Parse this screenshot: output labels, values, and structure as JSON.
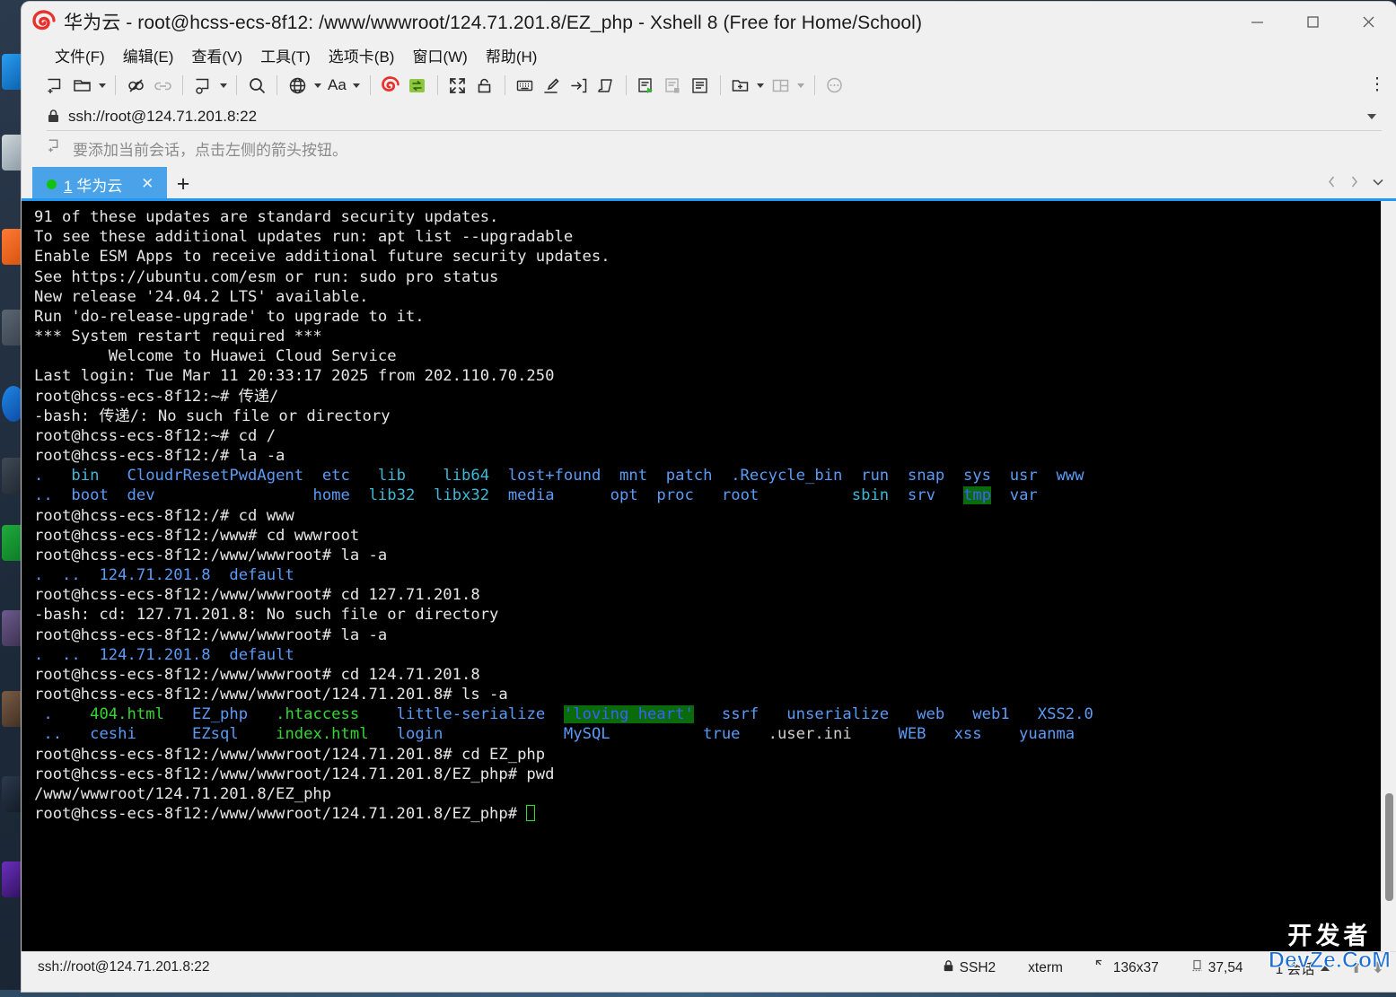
{
  "window": {
    "title": "华为云 - root@hcss-ecs-8f12: /www/wwwroot/124.71.201.8/EZ_php - Xshell 8 (Free for Home/School)",
    "logo_icon": "xshell-spiral-logo-icon",
    "minimize_label": "minimize",
    "maximize_label": "maximize",
    "close_label": "close"
  },
  "menubar": {
    "items": [
      {
        "label": "文件(F)",
        "name": "menu-file"
      },
      {
        "label": "编辑(E)",
        "name": "menu-edit"
      },
      {
        "label": "查看(V)",
        "name": "menu-view"
      },
      {
        "label": "工具(T)",
        "name": "menu-tools"
      },
      {
        "label": "选项卡(B)",
        "name": "menu-tabs"
      },
      {
        "label": "窗口(W)",
        "name": "menu-window"
      },
      {
        "label": "帮助(H)",
        "name": "menu-help"
      }
    ]
  },
  "toolbar": {
    "font_label": "Aa",
    "overflow_label": "⋮",
    "icons": [
      "new-session-icon",
      "open-folder-icon",
      "disconnect-icon",
      "link-icon",
      "session-properties-icon",
      "find-icon",
      "globe-icon",
      "font-icon",
      "xshell-logo-icon",
      "xftp-icon",
      "fullscreen-icon",
      "lock-icon",
      "keyboard-icon",
      "highlight-icon",
      "send-key-icon",
      "script-icon",
      "run-script-icon",
      "stop-script-icon",
      "log-icon",
      "new-folder-icon",
      "split-layout-icon",
      "chat-icon"
    ]
  },
  "address_bar": {
    "lock_icon": "lock-icon",
    "value": "ssh://root@124.71.201.8:22",
    "dropdown_icon": "chevron-down-icon"
  },
  "hint_row": {
    "icon": "add-session-icon",
    "text": "要添加当前会话，点击左侧的箭头按钮。"
  },
  "tabbar": {
    "active_tab": {
      "status_dot": "connected-dot",
      "number": "1",
      "label": " 华为云",
      "close_icon": "close-icon"
    },
    "new_tab_label": "+",
    "prev_icon": "chevron-left-icon",
    "next_icon": "chevron-right-icon",
    "list_icon": "chevron-down-icon"
  },
  "terminal": {
    "lines": [
      [
        {
          "t": "91 of these updates are standard security updates.",
          "c": "c-white"
        }
      ],
      [
        {
          "t": "To see these additional updates run: apt list --upgradable",
          "c": "c-white"
        }
      ],
      [
        {
          "t": "",
          "c": "c-white"
        }
      ],
      [
        {
          "t": "Enable ESM Apps to receive additional future security updates.",
          "c": "c-white"
        }
      ],
      [
        {
          "t": "See https://ubuntu.com/esm or run: sudo pro status",
          "c": "c-white"
        }
      ],
      [
        {
          "t": "",
          "c": "c-white"
        }
      ],
      [
        {
          "t": "New release '24.04.2 LTS' available.",
          "c": "c-white"
        }
      ],
      [
        {
          "t": "Run 'do-release-upgrade' to upgrade to it.",
          "c": "c-white"
        }
      ],
      [
        {
          "t": "",
          "c": "c-white"
        }
      ],
      [
        {
          "t": "",
          "c": "c-white"
        }
      ],
      [
        {
          "t": "*** System restart required ***",
          "c": "c-white"
        }
      ],
      [
        {
          "t": "",
          "c": "c-white"
        }
      ],
      [
        {
          "t": "        Welcome to Huawei Cloud Service",
          "c": "c-white"
        }
      ],
      [
        {
          "t": "",
          "c": "c-white"
        }
      ],
      [
        {
          "t": "Last login: Tue Mar 11 20:33:17 2025 from 202.110.70.250",
          "c": "c-white"
        }
      ],
      [
        {
          "t": "root@hcss-ecs-8f12:~# 传递/",
          "c": "c-white"
        }
      ],
      [
        {
          "t": "-bash: 传递/: No such file or directory",
          "c": "c-white"
        }
      ],
      [
        {
          "t": "root@hcss-ecs-8f12:~# cd /",
          "c": "c-white"
        }
      ],
      [
        {
          "t": "root@hcss-ecs-8f12:/# la -a",
          "c": "c-white"
        }
      ],
      [
        {
          "t": ".   ",
          "c": "c-blue"
        },
        {
          "t": "bin",
          "c": "c-cyan"
        },
        {
          "t": "   ",
          "c": "c-white"
        },
        {
          "t": "CloudrResetPwdAgent",
          "c": "c-blue"
        },
        {
          "t": "  ",
          "c": "c-white"
        },
        {
          "t": "etc",
          "c": "c-blue"
        },
        {
          "t": "   ",
          "c": "c-white"
        },
        {
          "t": "lib",
          "c": "c-cyan"
        },
        {
          "t": "    ",
          "c": "c-white"
        },
        {
          "t": "lib64",
          "c": "c-cyan"
        },
        {
          "t": "  ",
          "c": "c-white"
        },
        {
          "t": "lost+found",
          "c": "c-blue"
        },
        {
          "t": "  ",
          "c": "c-white"
        },
        {
          "t": "mnt",
          "c": "c-blue"
        },
        {
          "t": "  ",
          "c": "c-white"
        },
        {
          "t": "patch",
          "c": "c-blue"
        },
        {
          "t": "  ",
          "c": "c-white"
        },
        {
          "t": ".Recycle_bin",
          "c": "c-blue"
        },
        {
          "t": "  ",
          "c": "c-white"
        },
        {
          "t": "run",
          "c": "c-blue"
        },
        {
          "t": "  ",
          "c": "c-white"
        },
        {
          "t": "snap",
          "c": "c-blue"
        },
        {
          "t": "  ",
          "c": "c-white"
        },
        {
          "t": "sys",
          "c": "c-blue"
        },
        {
          "t": "  ",
          "c": "c-white"
        },
        {
          "t": "usr",
          "c": "c-blue"
        },
        {
          "t": "  ",
          "c": "c-white"
        },
        {
          "t": "www",
          "c": "c-blue"
        }
      ],
      [
        {
          "t": ".. ",
          "c": "c-blue"
        },
        {
          "t": " boot",
          "c": "c-blue"
        },
        {
          "t": "  ",
          "c": "c-white"
        },
        {
          "t": "dev",
          "c": "c-blue"
        },
        {
          "t": "                 ",
          "c": "c-white"
        },
        {
          "t": "home",
          "c": "c-blue"
        },
        {
          "t": "  ",
          "c": "c-white"
        },
        {
          "t": "lib32",
          "c": "c-cyan"
        },
        {
          "t": "  ",
          "c": "c-white"
        },
        {
          "t": "libx32",
          "c": "c-cyan"
        },
        {
          "t": "  ",
          "c": "c-white"
        },
        {
          "t": "media",
          "c": "c-blue"
        },
        {
          "t": "      ",
          "c": "c-white"
        },
        {
          "t": "opt",
          "c": "c-blue"
        },
        {
          "t": "  ",
          "c": "c-white"
        },
        {
          "t": "proc",
          "c": "c-blue"
        },
        {
          "t": "   ",
          "c": "c-white"
        },
        {
          "t": "root",
          "c": "c-blue"
        },
        {
          "t": "          ",
          "c": "c-white"
        },
        {
          "t": "sbin",
          "c": "c-cyan"
        },
        {
          "t": "  ",
          "c": "c-white"
        },
        {
          "t": "srv",
          "c": "c-blue"
        },
        {
          "t": "   ",
          "c": "c-white"
        },
        {
          "t": "tmp",
          "c": "c-dirsel"
        },
        {
          "t": "  ",
          "c": "c-white"
        },
        {
          "t": "var",
          "c": "c-blue"
        }
      ],
      [
        {
          "t": "root@hcss-ecs-8f12:/# cd www",
          "c": "c-white"
        }
      ],
      [
        {
          "t": "root@hcss-ecs-8f12:/www# cd wwwroot",
          "c": "c-white"
        }
      ],
      [
        {
          "t": "root@hcss-ecs-8f12:/www/wwwroot# la -a",
          "c": "c-white"
        }
      ],
      [
        {
          "t": ".  ",
          "c": "c-blue"
        },
        {
          "t": ".. ",
          "c": "c-blue"
        },
        {
          "t": " ",
          "c": "c-white"
        },
        {
          "t": "124.71.201.8",
          "c": "c-blue"
        },
        {
          "t": "  ",
          "c": "c-white"
        },
        {
          "t": "default",
          "c": "c-blue"
        }
      ],
      [
        {
          "t": "root@hcss-ecs-8f12:/www/wwwroot# cd 127.71.201.8",
          "c": "c-white"
        }
      ],
      [
        {
          "t": "-bash: cd: 127.71.201.8: No such file or directory",
          "c": "c-white"
        }
      ],
      [
        {
          "t": "root@hcss-ecs-8f12:/www/wwwroot# la -a",
          "c": "c-white"
        }
      ],
      [
        {
          "t": ".  ",
          "c": "c-blue"
        },
        {
          "t": ".. ",
          "c": "c-blue"
        },
        {
          "t": " ",
          "c": "c-white"
        },
        {
          "t": "124.71.201.8",
          "c": "c-blue"
        },
        {
          "t": "  ",
          "c": "c-white"
        },
        {
          "t": "default",
          "c": "c-blue"
        }
      ],
      [
        {
          "t": "root@hcss-ecs-8f12:/www/wwwroot# cd 124.71.201.8",
          "c": "c-white"
        }
      ],
      [
        {
          "t": "root@hcss-ecs-8f12:/www/wwwroot/124.71.201.8# ls -a",
          "c": "c-white"
        }
      ],
      [
        {
          "t": " .",
          "c": "c-blue"
        },
        {
          "t": "    ",
          "c": "c-white"
        },
        {
          "t": "404.html",
          "c": "c-green"
        },
        {
          "t": "   ",
          "c": "c-white"
        },
        {
          "t": "EZ_php",
          "c": "c-blue"
        },
        {
          "t": "   ",
          "c": "c-white"
        },
        {
          "t": ".htaccess",
          "c": "c-green"
        },
        {
          "t": "    ",
          "c": "c-white"
        },
        {
          "t": "little-serialize",
          "c": "c-blue"
        },
        {
          "t": "  ",
          "c": "c-white"
        },
        {
          "t": "'loving heart'",
          "c": "c-dirsel"
        },
        {
          "t": "   ",
          "c": "c-white"
        },
        {
          "t": "ssrf",
          "c": "c-blue"
        },
        {
          "t": "   ",
          "c": "c-white"
        },
        {
          "t": "unserialize",
          "c": "c-blue"
        },
        {
          "t": "   ",
          "c": "c-white"
        },
        {
          "t": "web",
          "c": "c-blue"
        },
        {
          "t": "   ",
          "c": "c-white"
        },
        {
          "t": "web1",
          "c": "c-blue"
        },
        {
          "t": "   ",
          "c": "c-white"
        },
        {
          "t": "XSS2.0",
          "c": "c-blue"
        }
      ],
      [
        {
          "t": " ..",
          "c": "c-blue"
        },
        {
          "t": "   ",
          "c": "c-white"
        },
        {
          "t": "ceshi",
          "c": "c-blue"
        },
        {
          "t": "      ",
          "c": "c-white"
        },
        {
          "t": "EZsql",
          "c": "c-blue"
        },
        {
          "t": "    ",
          "c": "c-white"
        },
        {
          "t": "index.html",
          "c": "c-green"
        },
        {
          "t": "   ",
          "c": "c-white"
        },
        {
          "t": "login",
          "c": "c-blue"
        },
        {
          "t": "             ",
          "c": "c-white"
        },
        {
          "t": "MySQL",
          "c": "c-blue"
        },
        {
          "t": "          ",
          "c": "c-white"
        },
        {
          "t": "true",
          "c": "c-blue"
        },
        {
          "t": "   ",
          "c": "c-white"
        },
        {
          "t": ".user.ini",
          "c": "c-grey"
        },
        {
          "t": "     ",
          "c": "c-white"
        },
        {
          "t": "WEB",
          "c": "c-blue"
        },
        {
          "t": "   ",
          "c": "c-white"
        },
        {
          "t": "xss",
          "c": "c-blue"
        },
        {
          "t": "    ",
          "c": "c-white"
        },
        {
          "t": "yuanma",
          "c": "c-blue"
        }
      ],
      [
        {
          "t": "root@hcss-ecs-8f12:/www/wwwroot/124.71.201.8# cd EZ_php",
          "c": "c-white"
        }
      ],
      [
        {
          "t": "root@hcss-ecs-8f12:/www/wwwroot/124.71.201.8/EZ_php# pwd",
          "c": "c-white"
        }
      ],
      [
        {
          "t": "/www/wwwroot/124.71.201.8/EZ_php",
          "c": "c-white"
        }
      ],
      [
        {
          "t": "root@hcss-ecs-8f12:/www/wwwroot/124.71.201.8/EZ_php# ",
          "c": "c-white"
        },
        {
          "t": "",
          "c": "cursor-marker"
        }
      ]
    ]
  },
  "statusbar": {
    "connection": "ssh://root@124.71.201.8:22",
    "security_icon": "lock-icon",
    "protocol": "SSH2",
    "terminal_type": "xterm",
    "size_icon": "screen-size-icon",
    "size": "136x37",
    "cursor_icon": "cursor-position-icon",
    "cursor_position": "37,54",
    "sessions": "1 会话",
    "sessions_caret": "caret-up-icon",
    "upload_icon": "upload-arrow-icon",
    "download_icon": "download-arrow-icon"
  },
  "watermark": {
    "cn": "开发者",
    "en": "DevZe.CoM"
  }
}
